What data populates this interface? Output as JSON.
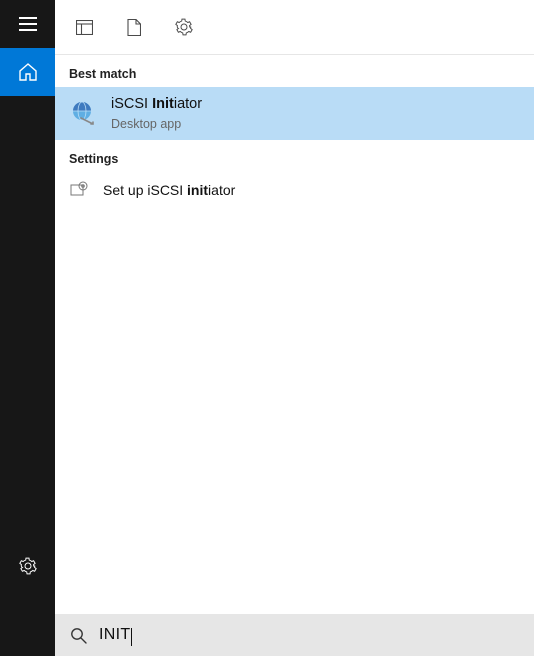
{
  "rail": {
    "menu": "menu",
    "home": "home",
    "settings": "settings"
  },
  "filters": {
    "apps": "apps",
    "documents": "documents",
    "settings": "settings"
  },
  "sections": {
    "best_match": "Best match",
    "settings": "Settings"
  },
  "results": {
    "best": {
      "title_prefix": "iSCSI ",
      "title_bold": "Init",
      "title_suffix": "iator",
      "subtitle": "Desktop app"
    },
    "settings_item": {
      "title_prefix": "Set up iSCSI ",
      "title_bold": "init",
      "title_suffix": "iator"
    }
  },
  "search": {
    "query": "INIT"
  }
}
